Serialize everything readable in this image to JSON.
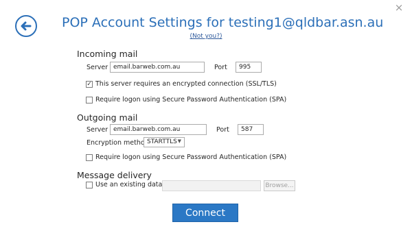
{
  "dialog": {
    "title": "POP Account Settings for testing1@qldbar.asn.au",
    "not_you": "(Not you?)",
    "close_glyph": "×"
  },
  "incoming": {
    "heading": "Incoming mail",
    "server_label": "Server",
    "server_value": "email.barweb.com.au",
    "port_label": "Port",
    "port_value": "995",
    "ssl_label": "This server requires an encrypted connection (SSL/TLS)",
    "ssl_checked": true,
    "spa_label": "Require logon using Secure Password Authentication (SPA)",
    "spa_checked": false
  },
  "outgoing": {
    "heading": "Outgoing mail",
    "server_label": "Server",
    "server_value": "email.barweb.com.au",
    "port_label": "Port",
    "port_value": "587",
    "encryption_label": "Encryption method",
    "encryption_value": "STARTTLS",
    "spa_label": "Require logon using Secure Password Authentication (SPA)",
    "spa_checked": false
  },
  "delivery": {
    "heading": "Message delivery",
    "existing_label": "Use an existing data file",
    "existing_checked": false,
    "browse_label": "Browse..."
  },
  "actions": {
    "connect_label": "Connect"
  },
  "colors": {
    "accent": "#2b78c5",
    "title": "#2b6fb8"
  }
}
